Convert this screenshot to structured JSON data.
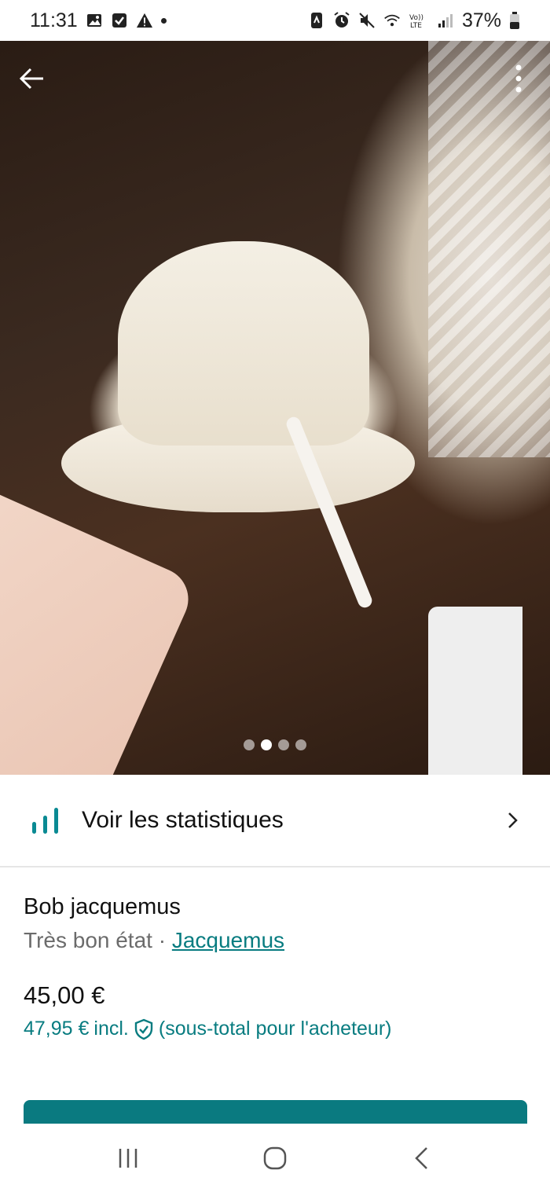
{
  "status_bar": {
    "time": "11:31",
    "battery": "37%",
    "icons": [
      "gallery-icon",
      "checkbox-icon",
      "warning-icon",
      "notification-dot-icon",
      "nfc-icon",
      "alarm-icon",
      "mute-icon",
      "wifi-icon",
      "volte-icon",
      "signal-icon",
      "battery-icon"
    ]
  },
  "header": {
    "back_icon": "arrow-left-icon",
    "more_icon": "more-vertical-icon"
  },
  "gallery": {
    "image_count": 4,
    "active_index": 1
  },
  "stats": {
    "label": "Voir les statistiques",
    "icon": "bar-chart-icon",
    "accent_color": "#0a8a93"
  },
  "item": {
    "title": "Bob jacquemus",
    "condition": "Très bon état",
    "separator": "·",
    "brand": "Jacquemus",
    "price": "45,00 €",
    "price_total": "47,95 €",
    "price_incl": "incl.",
    "price_note": "(sous-total pour l'acheteur)"
  },
  "colors": {
    "accent": "#087c80",
    "cta": "#0a7a80"
  },
  "nav_bar": {
    "icons": [
      "recents-icon",
      "home-icon",
      "back-icon"
    ]
  }
}
